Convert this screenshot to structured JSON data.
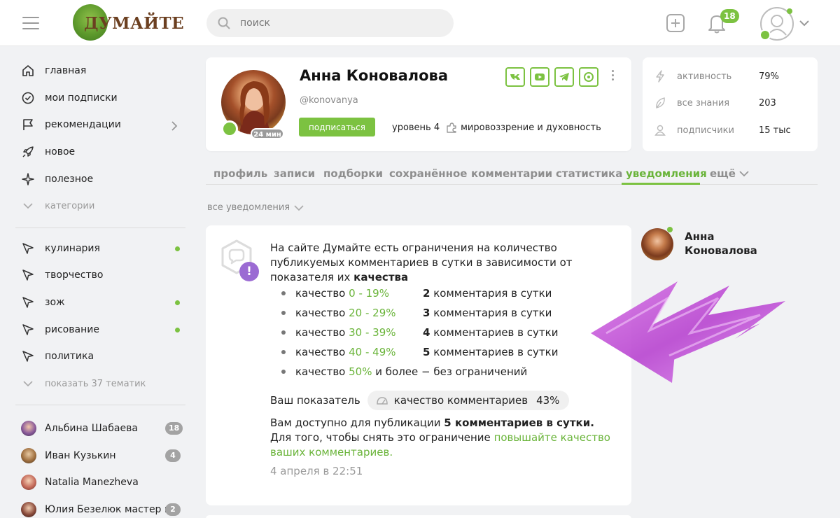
{
  "header": {
    "logo_text": "ДУМАЙТЕ",
    "search_placeholder": "поиск",
    "notifications_count": "18"
  },
  "sidebar": {
    "nav": [
      {
        "label": "главная",
        "icon": "home-icon"
      },
      {
        "label": "мои подписки",
        "icon": "check-circle-icon"
      },
      {
        "label": "рекомендации",
        "icon": "flag-icon"
      },
      {
        "label": "новое",
        "icon": "rocket-icon"
      },
      {
        "label": "полезное",
        "icon": "sparkle-icon"
      }
    ],
    "categories_label": "категории",
    "topics": [
      {
        "label": "кулинария",
        "dot": true
      },
      {
        "label": "творчество",
        "dot": false
      },
      {
        "label": "зож",
        "dot": true
      },
      {
        "label": "рисование",
        "dot": true
      },
      {
        "label": "политика",
        "dot": false
      }
    ],
    "show_more_topics": "показать 37 тематик",
    "people": [
      {
        "name": "Альбина Шабаева",
        "badge": "18"
      },
      {
        "name": "Иван Кузькин",
        "badge": "4"
      },
      {
        "name": "Natalia Manezheva",
        "badge": ""
      },
      {
        "name": "Юлия Безелюк мастер к...",
        "badge": "2"
      }
    ]
  },
  "profile": {
    "name": "Анна Коновалова",
    "handle": "@konovanya",
    "avatar_time": "24 мин",
    "subscribe_label": "подписаться",
    "level": "уровень 4",
    "category": "мировоззрение и духовность",
    "socials": [
      "vk-icon",
      "youtube-icon",
      "telegram-icon",
      "dzen-icon"
    ]
  },
  "stats": [
    {
      "label": "активность",
      "value": "79%",
      "icon": "bolt-icon"
    },
    {
      "label": "все знания",
      "value": "203",
      "icon": "leaf-icon"
    },
    {
      "label": "подписчики",
      "value": "15 тыс",
      "icon": "user-icon"
    }
  ],
  "tabs": [
    "профиль",
    "записи",
    "подборки",
    "сохранённое",
    "комментарии",
    "статистика",
    "уведомления",
    "ещё"
  ],
  "active_tab": "уведомления",
  "filter_label": "все уведомления",
  "notification": {
    "text_main": "На сайте Думайте есть ограничения на количество публикуемых комментариев в сутки в зависимости от показателя их ",
    "text_bold": "качества",
    "rules": [
      {
        "label": "качество",
        "range": "0 - 19%",
        "count": "2",
        "rest": "комментария в сутки"
      },
      {
        "label": "качество",
        "range": "20 - 29%",
        "count": "3",
        "rest": "комментария в сутки"
      },
      {
        "label": "качество",
        "range": "30 - 39%",
        "count": "4",
        "rest": "комментариев в сутки"
      },
      {
        "label": "качество",
        "range": "40 - 49%",
        "count": "5",
        "rest": "комментариев в сутки"
      },
      {
        "label": "качество",
        "range": "50%",
        "count": "",
        "rest": "и более − без ограничений"
      }
    ],
    "score_label": "Ваш показатель",
    "score_chip_label": "качество комментариев",
    "score_value": "43%",
    "available_prefix": "Вам доступно для публикации ",
    "available_bold": "5 комментариев в сутки.",
    "limit_prefix": "Для того, чтобы снять это ограничение ",
    "limit_link": "повышайте качество ваших комментариев.",
    "date": "4 апреля в 22:51"
  },
  "author": {
    "name": "Анна Коновалова"
  },
  "colors": {
    "accent": "#7cc241",
    "accent_text": "#6ab43a",
    "alert_purple": "#9b6bd3",
    "arrow_purple": "#c855d8"
  }
}
